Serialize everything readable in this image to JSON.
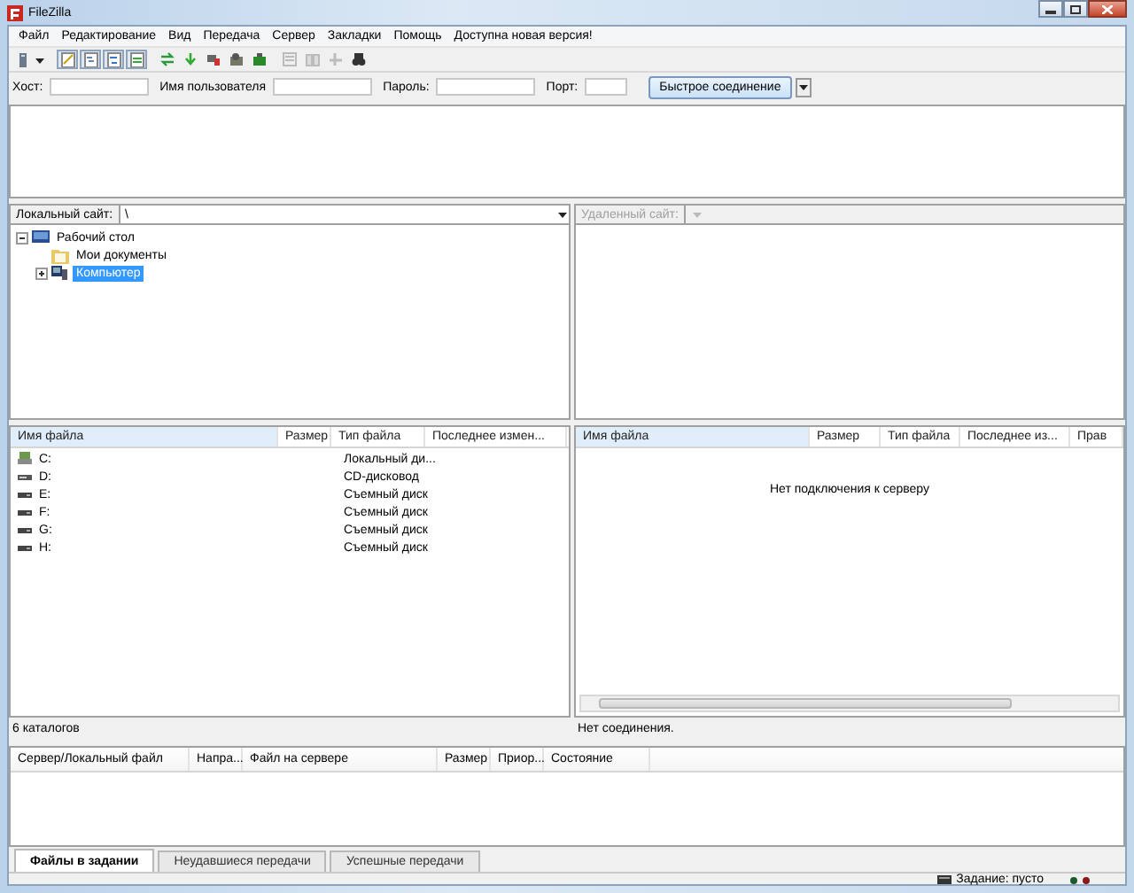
{
  "window": {
    "title": "FileZilla"
  },
  "menu": [
    "Файл",
    "Редактирование",
    "Вид",
    "Передача",
    "Сервер",
    "Закладки",
    "Помощь",
    "Доступна новая версия!"
  ],
  "toolbar": [
    {
      "kind": "site-manager",
      "pressed": false
    },
    {
      "kind": "dropdown",
      "pressed": false
    },
    {
      "kind": "log",
      "pressed": true
    },
    {
      "kind": "local-tree",
      "pressed": true
    },
    {
      "kind": "remote-tree",
      "pressed": true
    },
    {
      "kind": "queue",
      "pressed": true
    },
    {
      "kind": "refresh",
      "pressed": false
    },
    {
      "kind": "process-queue",
      "pressed": false
    },
    {
      "kind": "cancel",
      "pressed": false
    },
    {
      "kind": "disconnect",
      "pressed": false
    },
    {
      "kind": "reconnect",
      "pressed": false
    },
    {
      "kind": "filter",
      "pressed": false
    },
    {
      "kind": "compare",
      "pressed": false
    },
    {
      "kind": "sync",
      "pressed": false
    },
    {
      "kind": "search",
      "pressed": false
    }
  ],
  "quickconnect": {
    "host_label": "Хост:",
    "user_label": "Имя пользователя",
    "password_label": "Пароль:",
    "port_label": "Порт:",
    "button": "Быстрое соединение"
  },
  "local": {
    "site_label": "Локальный сайт:",
    "path": "\\",
    "disabled": false,
    "tree": [
      {
        "label": "Рабочий стол",
        "kind": "desktop",
        "selected": false,
        "expanded": true,
        "children": [
          {
            "label": "Мои документы",
            "kind": "folder",
            "selected": false
          },
          {
            "label": "Компьютер",
            "kind": "computer",
            "selected": true,
            "expanded": false
          }
        ]
      }
    ],
    "columns": [
      "Имя файла",
      "Размер",
      "Тип файла",
      "Последнее измен..."
    ],
    "rows": [
      {
        "name": "C:",
        "type": "Локальный ди...",
        "kind": "hdd"
      },
      {
        "name": "D:",
        "type": "CD-дисковод",
        "kind": "cd"
      },
      {
        "name": "E:",
        "type": "Съемный диск",
        "kind": "removable"
      },
      {
        "name": "F:",
        "type": "Съемный диск",
        "kind": "removable"
      },
      {
        "name": "G:",
        "type": "Съемный диск",
        "kind": "removable"
      },
      {
        "name": "H:",
        "type": "Съемный диск",
        "kind": "removable"
      }
    ],
    "status": "6 каталогов"
  },
  "remote": {
    "site_label": "Удаленный сайт:",
    "disabled": true,
    "columns": [
      "Имя файла",
      "Размер",
      "Тип файла",
      "Последнее из...",
      "Прав"
    ],
    "message": "Нет подключения к серверу",
    "status": "Нет соединения."
  },
  "queue": {
    "columns": [
      "Сервер/Локальный файл",
      "Напра...",
      "Файл на сервере",
      "Размер",
      "Приор...",
      "Состояние"
    ],
    "tabs": [
      {
        "label": "Файлы в задании",
        "selected": true
      },
      {
        "label": "Неудавшиеся передачи",
        "selected": false
      },
      {
        "label": "Успешные передачи",
        "selected": false
      }
    ]
  },
  "status_bar": {
    "queue": "Задание: пусто"
  }
}
